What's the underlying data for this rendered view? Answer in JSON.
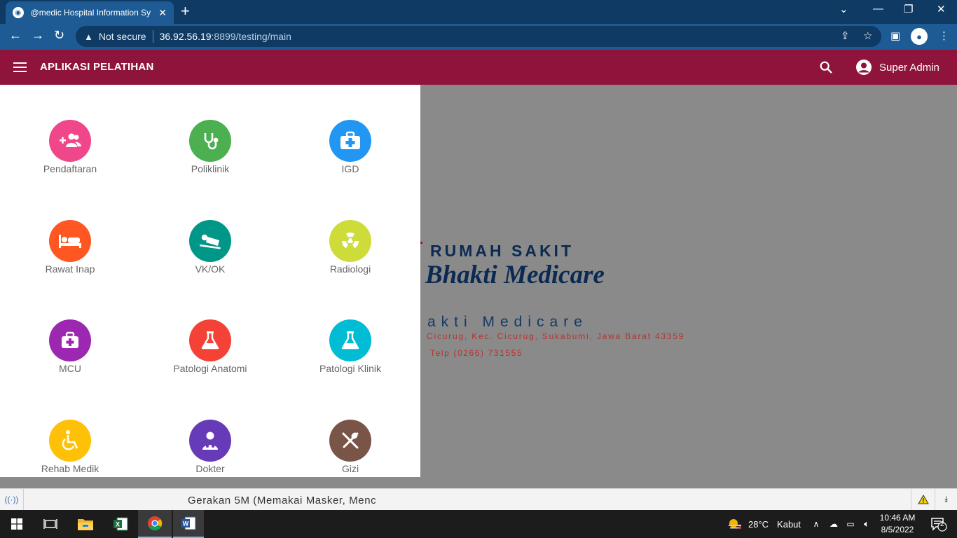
{
  "browser": {
    "tab_title": "@medic Hospital Information Sy",
    "security_label": "Not secure",
    "url_host": "36.92.56.19",
    "url_path": ":8899/testing/main",
    "window_controls": [
      "minimize",
      "maximize",
      "close"
    ]
  },
  "app": {
    "title": "APLIKASI PELATIHAN",
    "user_name": "Super Admin",
    "header_color": "#8e143c"
  },
  "menu": {
    "items": [
      {
        "label": "Pendaftaran",
        "icon": "add-users-icon",
        "color": "#f0478a"
      },
      {
        "label": "Poliklinik",
        "icon": "stethoscope-icon",
        "color": "#4caf50"
      },
      {
        "label": "IGD",
        "icon": "first-aid-kit-icon",
        "color": "#2196f3"
      },
      {
        "label": "Rawat Inap",
        "icon": "bed-icon",
        "color": "#ff5722"
      },
      {
        "label": "VK/OK",
        "icon": "patient-lying-icon",
        "color": "#009688"
      },
      {
        "label": "Radiologi",
        "icon": "radiation-icon",
        "color": "#cddc39"
      },
      {
        "label": "MCU",
        "icon": "medical-bag-icon",
        "color": "#9c27b0"
      },
      {
        "label": "Patologi Anatomi",
        "icon": "flask-icon",
        "color": "#f44336"
      },
      {
        "label": "Patologi Klinik",
        "icon": "flask-icon",
        "color": "#00bcd4"
      },
      {
        "label": "Rehab Medik",
        "icon": "wheelchair-icon",
        "color": "#ffc107"
      },
      {
        "label": "Dokter",
        "icon": "doctor-icon",
        "color": "#673ab7"
      },
      {
        "label": "Gizi",
        "icon": "utensils-icon",
        "color": "#795548"
      }
    ]
  },
  "brand": {
    "heading": "RUMAH SAKIT",
    "name": "Bhakti Medicare",
    "subtitle": "akti Medicare",
    "address": "Cicurug, Kec. Cicurug, Sukabumi, Jawa Barat 43359",
    "phone": "Telp (0266) 731555"
  },
  "ticker": {
    "text": "Gerakan 5M (Memakai Masker, Menc"
  },
  "taskbar": {
    "weather_temp": "28°C",
    "weather_desc": "Kabut",
    "time": "10:46 AM",
    "date": "8/5/2022",
    "notification_count": "2"
  }
}
